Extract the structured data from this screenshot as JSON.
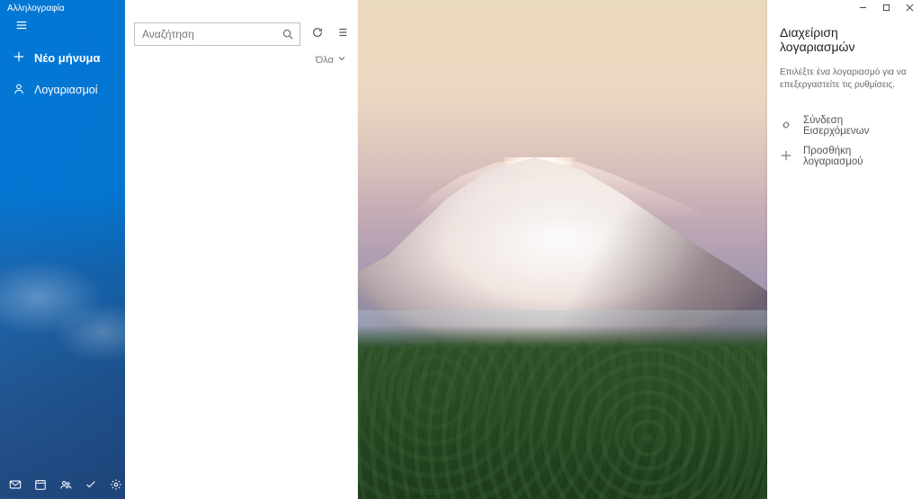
{
  "title": "Αλληλογραφία",
  "window_buttons": {
    "minimize": "–",
    "maximize": "▢",
    "close": "✕"
  },
  "sidebar": {
    "new_message": "Νέο μήνυμα",
    "accounts": "Λογαριασμοί",
    "bottom_icons": [
      "mail-icon",
      "calendar-icon",
      "people-icon",
      "todo-icon",
      "settings-icon"
    ]
  },
  "list": {
    "search_placeholder": "Αναζήτηση",
    "filter_label": "Όλα"
  },
  "panel": {
    "title": "Διαχείριση λογαριασμών",
    "subtitle": "Επιλέξτε ένα λογαριασμό για να επεξεργαστείτε τις ρυθμίσεις.",
    "link_inboxes": "Σύνδεση Εισερχόμενων",
    "add_account": "Προσθήκη λογαριασμού"
  }
}
